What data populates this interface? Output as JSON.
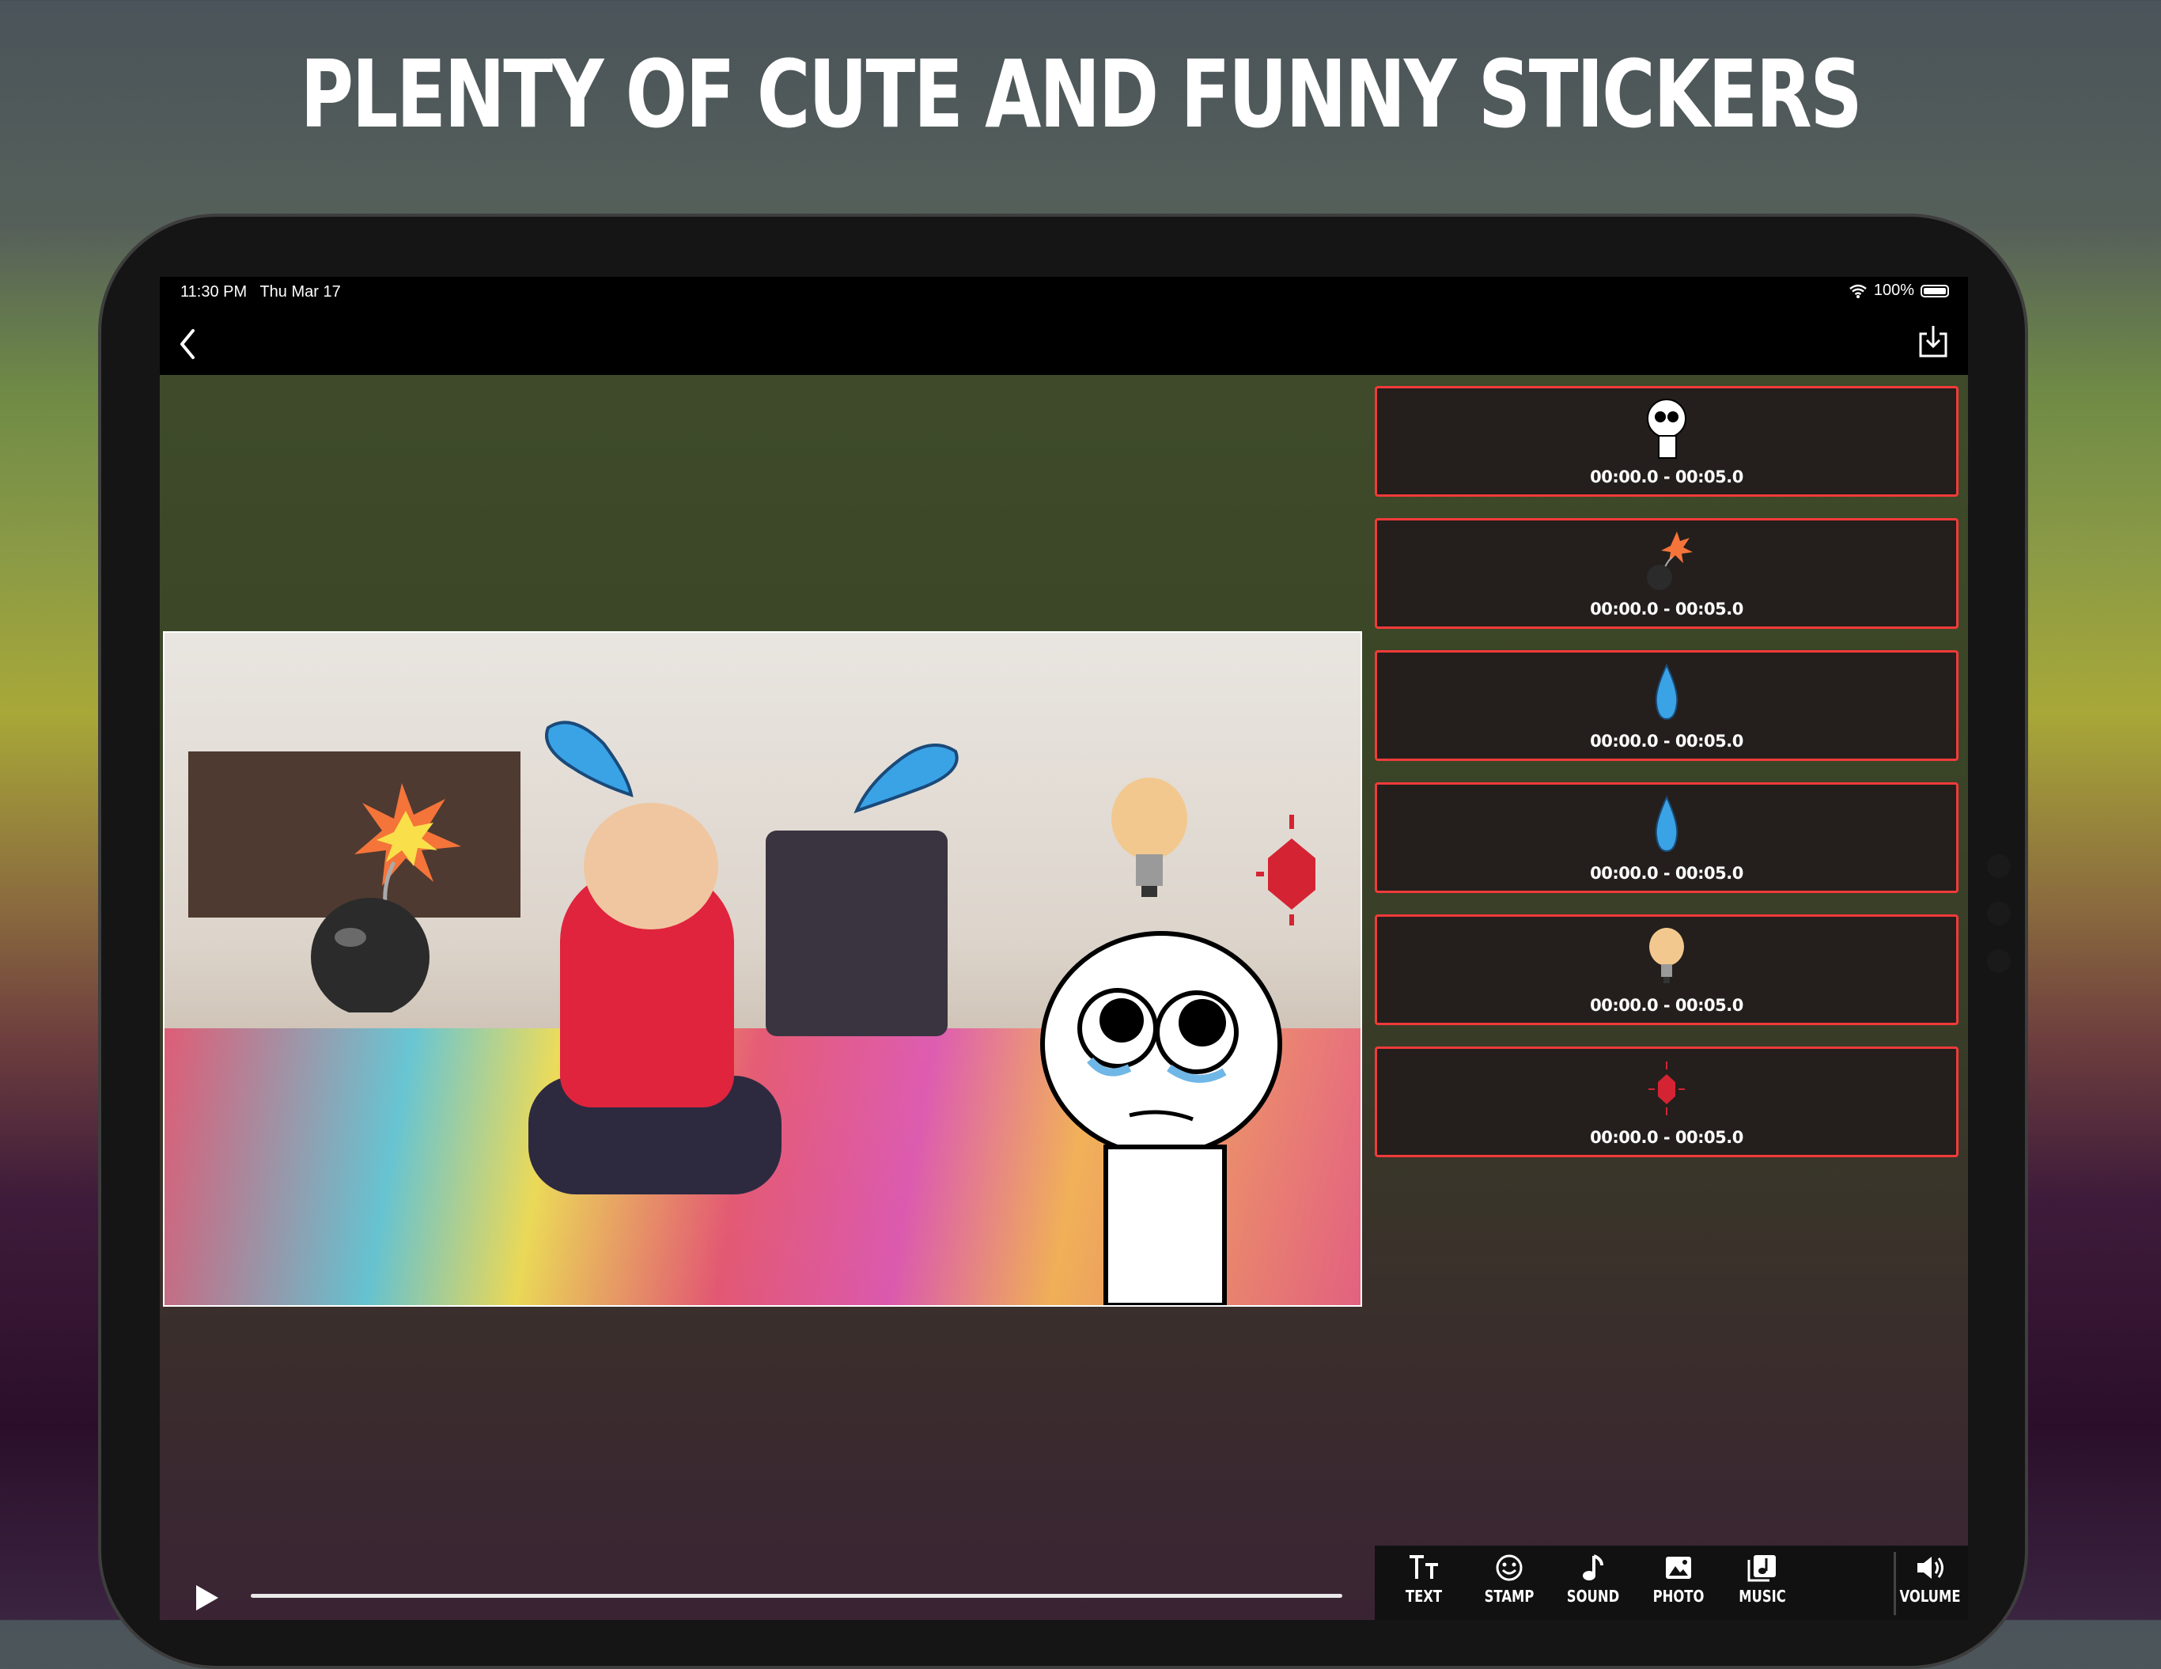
{
  "headline": "PLENTY OF CUTE AND FUNNY STICKERS",
  "status": {
    "time": "11:30 PM",
    "date": "Thu Mar 17",
    "battery": "100%"
  },
  "stickers": [
    {
      "icon": "meme-face-icon",
      "range": "00:00.0 - 00:05.0"
    },
    {
      "icon": "bomb-icon",
      "range": "00:00.0 - 00:05.0"
    },
    {
      "icon": "water-drop-icon",
      "range": "00:00.0 - 00:05.0"
    },
    {
      "icon": "water-drop-icon",
      "range": "00:00.0 - 00:05.0"
    },
    {
      "icon": "light-bulb-icon",
      "range": "00:00.0 - 00:05.0"
    },
    {
      "icon": "ruby-gem-icon",
      "range": "00:00.0 - 00:05.0"
    }
  ],
  "toolbar": {
    "text": "TEXT",
    "stamp": "STAMP",
    "sound": "SOUND",
    "photo": "PHOTO",
    "music": "MUSIC",
    "volume": "VOLUME"
  },
  "colors": {
    "card_border": "#f23a3a",
    "accent_blue": "#3aa3e6"
  }
}
